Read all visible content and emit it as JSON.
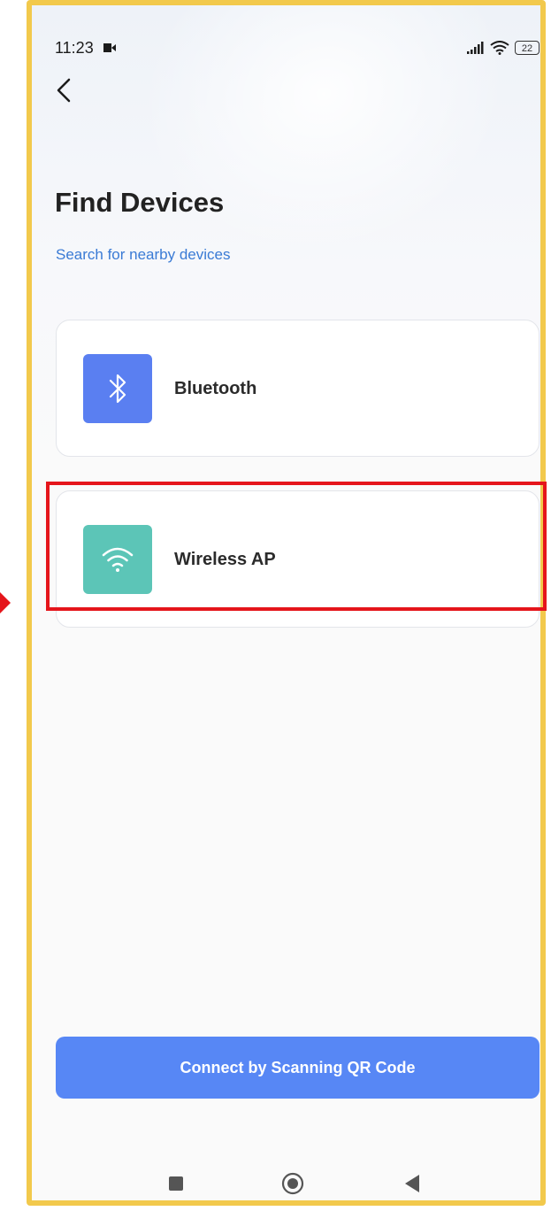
{
  "status_bar": {
    "time": "11:23",
    "battery": "22",
    "icons": [
      "camera-icon",
      "signal-icon",
      "wifi-signal-icon",
      "battery-icon"
    ]
  },
  "header": {
    "back_icon": "chevron-left-icon",
    "title": "Find Devices",
    "subtitle": "Search for nearby devices"
  },
  "options": [
    {
      "label": "Bluetooth",
      "icon": "bluetooth-icon",
      "icon_color": "#5a7ff1"
    },
    {
      "label": "Wireless AP",
      "icon": "wifi-icon",
      "icon_color": "#5cc5b7"
    }
  ],
  "qr_button": {
    "label": "Connect by Scanning QR Code",
    "color": "#5787f5"
  },
  "nav_bar": {
    "icons": [
      "recent-apps-icon",
      "home-icon",
      "back-triangle-icon"
    ]
  },
  "colors": {
    "accent": "#3a7bd5",
    "frame": "#f2c94c",
    "highlight": "#e5151b"
  }
}
